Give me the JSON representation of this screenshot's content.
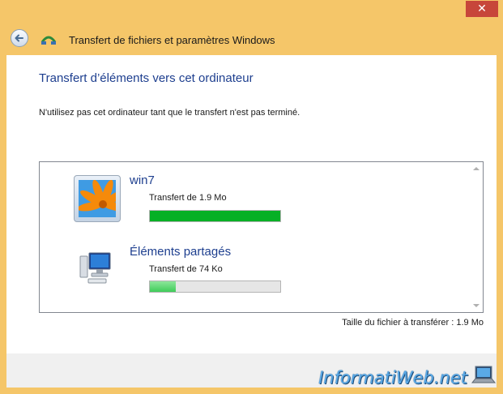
{
  "window": {
    "close_glyph": "✕",
    "title": "Transfert de fichiers et paramètres Windows"
  },
  "page": {
    "heading": "Transfert d’éléments vers cet ordinateur",
    "notice": "N'utilisez pas cet ordinateur tant que le transfert n'est pas terminé."
  },
  "items": [
    {
      "name": "win7",
      "status": "Transfert de 1.9 Mo",
      "progress": 1.0,
      "icon": "user-picture-icon"
    },
    {
      "name": "Éléments partagés",
      "status": "Transfert de 74 Ko",
      "progress": 0.2,
      "icon": "computer-icon"
    }
  ],
  "summary": {
    "file_size": "Taille du fichier à transférer : 1.9 Mo"
  },
  "watermark": {
    "text": "InformatiWeb.net"
  },
  "colors": {
    "accent": "#1e3f8f",
    "progress": "#06b025",
    "frame": "#f5c669"
  }
}
